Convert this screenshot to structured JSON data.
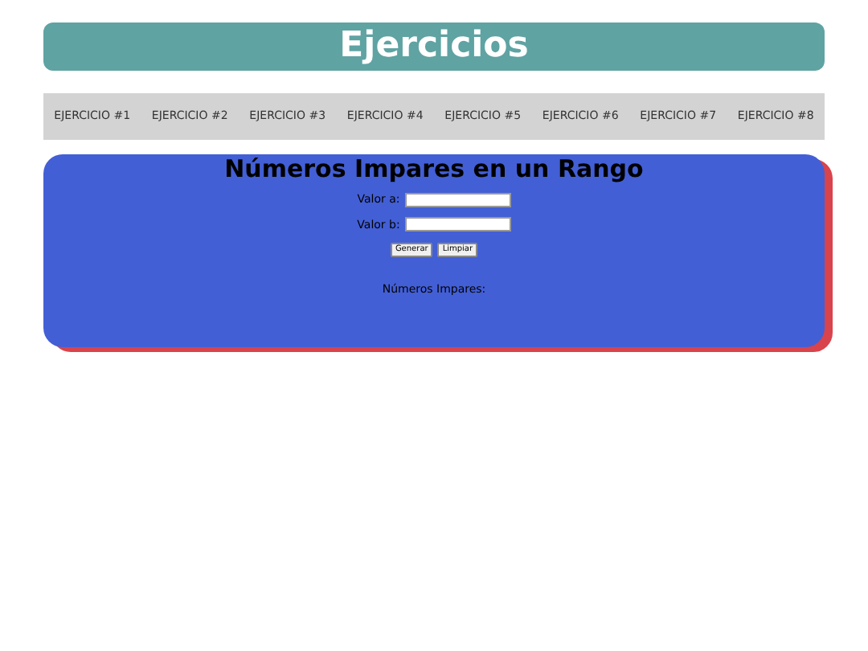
{
  "header": {
    "title": "Ejercicios"
  },
  "nav": [
    {
      "label": "EJERCICIO #1"
    },
    {
      "label": "EJERCICIO #2"
    },
    {
      "label": "EJERCICIO #3"
    },
    {
      "label": "EJERCICIO #4"
    },
    {
      "label": "EJERCICIO #5"
    },
    {
      "label": "EJERCICIO #6"
    },
    {
      "label": "EJERCICIO #7"
    },
    {
      "label": "EJERCICIO #8"
    }
  ],
  "panel": {
    "title": "Números Impares en un Rango",
    "fields": [
      {
        "label": "Valor a:"
      },
      {
        "label": "Valor b:"
      }
    ],
    "buttons": [
      "Generar",
      "Limpiar"
    ],
    "result_label": "Números Impares:"
  }
}
